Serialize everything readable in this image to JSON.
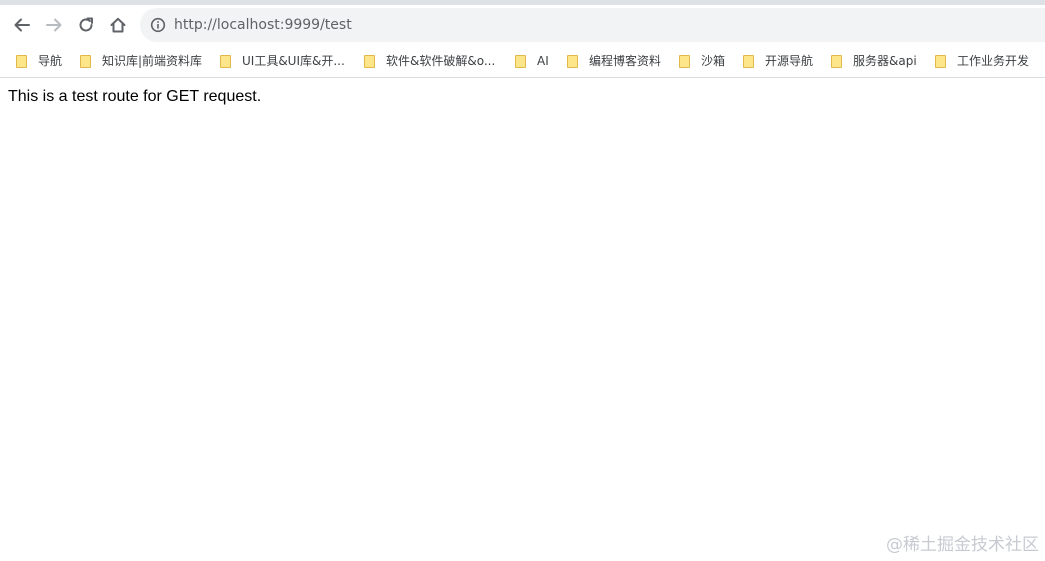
{
  "browser": {
    "url": "http://localhost:9999/test",
    "nav_icons": [
      "back-arrow-icon",
      "forward-arrow-icon",
      "reload-icon",
      "home-icon",
      "info-icon"
    ]
  },
  "bookmarks": [
    {
      "label": "导航"
    },
    {
      "label": "知识库|前端资料库"
    },
    {
      "label": "UI工具&UI库&开..."
    },
    {
      "label": "软件&软件破解&o..."
    },
    {
      "label": "AI"
    },
    {
      "label": "编程博客资料"
    },
    {
      "label": "沙箱"
    },
    {
      "label": "开源导航"
    },
    {
      "label": "服务器&api"
    },
    {
      "label": "工作业务开发"
    }
  ],
  "page": {
    "body_text": "This is a test route for GET request."
  },
  "watermark": "@稀土掘金技术社区",
  "colors": {
    "omnibox_bg": "#f1f3f4",
    "folder_icon": "#fde68a",
    "icon_gray": "#5f6368"
  }
}
